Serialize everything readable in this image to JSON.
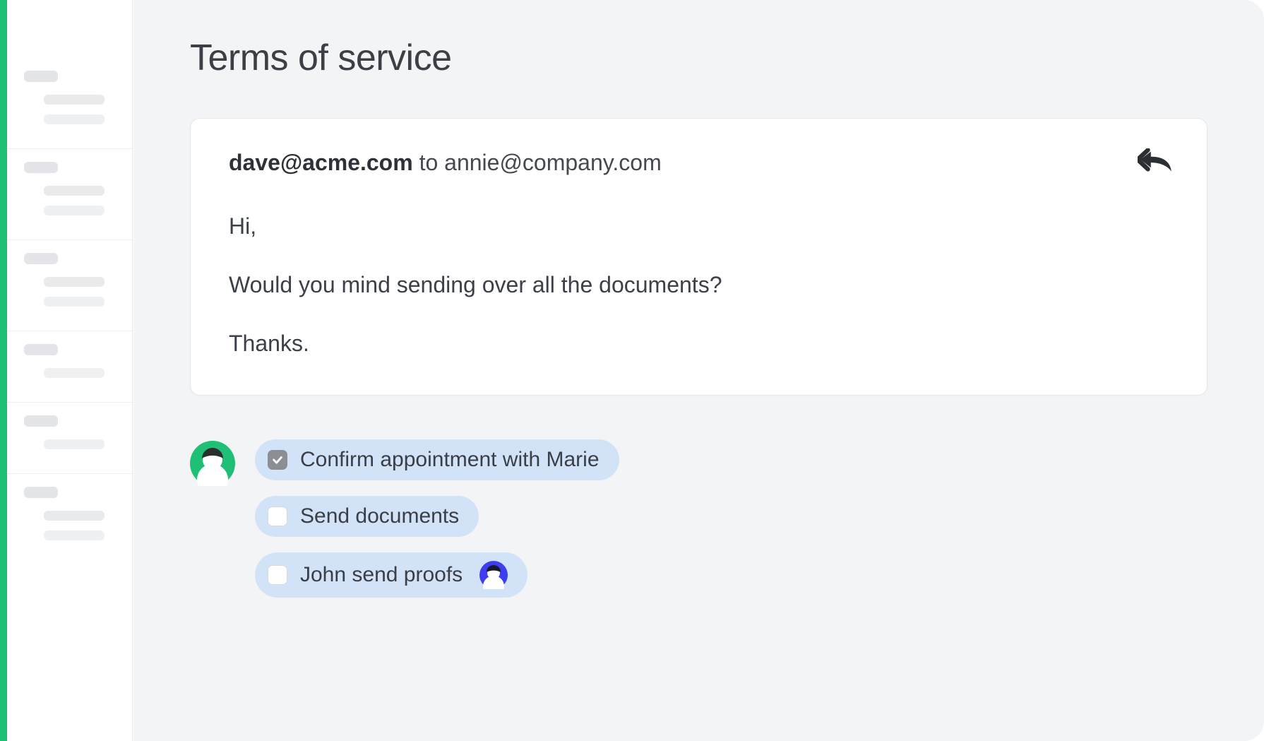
{
  "page": {
    "title": "Terms of service"
  },
  "email": {
    "from": "dave@acme.com",
    "to_word": "to",
    "to": "annie@company.com",
    "body": {
      "greeting": "Hi,",
      "line1": "Would you mind sending over all the documents?",
      "signoff": "Thanks."
    }
  },
  "tasks": [
    {
      "label": "Confirm appointment with Marie",
      "checked": true,
      "hasAssignee": false
    },
    {
      "label": "Send documents",
      "checked": false,
      "hasAssignee": false
    },
    {
      "label": "John send proofs",
      "checked": false,
      "hasAssignee": true
    }
  ],
  "colors": {
    "accentGreen": "#1fbf75",
    "chipBlue": "#d3e3f7",
    "assigneeBlue": "#3e3ef0"
  }
}
